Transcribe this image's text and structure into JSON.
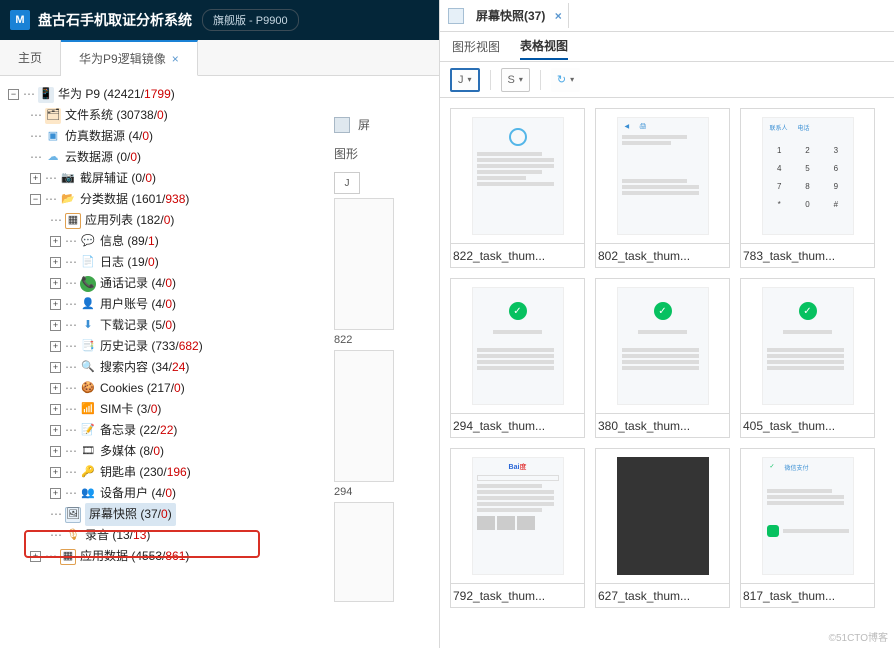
{
  "titlebar": {
    "logo": "M",
    "title": "盘古石手机取证分析系统",
    "badge": "旗舰版 - P9900"
  },
  "left_tabs": {
    "home": "主页",
    "active": "华为P9逻辑镜像"
  },
  "tree": {
    "root": {
      "label": "华为 P9 (42421/",
      "red": "1799",
      "tail": ")"
    },
    "fs": {
      "label": "文件系统 (30738/",
      "red": "0",
      "tail": ")"
    },
    "fake": {
      "label": "仿真数据源 (4/",
      "red": "0",
      "tail": ")"
    },
    "cloud": {
      "label": "云数据源 (0/",
      "red": "0",
      "tail": ")"
    },
    "screencap": {
      "label": "截屏辅证 (0/",
      "red": "0",
      "tail": ")"
    },
    "category": {
      "label": "分类数据 (1601/",
      "red": "938",
      "tail": ")"
    },
    "applist": {
      "label": "应用列表 (182/",
      "red": "0",
      "tail": ")"
    },
    "msg": {
      "label": "信息 (89/",
      "red": "1",
      "tail": ")"
    },
    "log": {
      "label": "日志 (19/",
      "red": "0",
      "tail": ")"
    },
    "call": {
      "label": "通话记录 (4/",
      "red": "0",
      "tail": ")"
    },
    "user": {
      "label": "用户账号 (4/",
      "red": "0",
      "tail": ")"
    },
    "download": {
      "label": "下载记录 (5/",
      "red": "0",
      "tail": ")"
    },
    "history": {
      "label": "历史记录 (733/",
      "red": "682",
      "tail": ")"
    },
    "search": {
      "label": "搜索内容 (34/",
      "red": "24",
      "tail": ")"
    },
    "cookies": {
      "label": "Cookies (217/",
      "red": "0",
      "tail": ")"
    },
    "sim": {
      "label": "SIM卡 (3/",
      "red": "0",
      "tail": ")"
    },
    "memo": {
      "label": "备忘录 (22/",
      "red": "22",
      "tail": ")"
    },
    "media": {
      "label": "多媒体 (8/",
      "red": "0",
      "tail": ")"
    },
    "keychain": {
      "label": "钥匙串 (230/",
      "red": "196",
      "tail": ")"
    },
    "devuser": {
      "label": "设备用户 (4/",
      "red": "0",
      "tail": ")"
    },
    "screenshot": {
      "label": "屏幕快照 (37/",
      "red": "0",
      "tail": ")"
    },
    "audio": {
      "label": "录音 (13/",
      "red": "13",
      "tail": ")"
    },
    "appdata": {
      "label": "应用数据 (4553/",
      "red": "861",
      "tail": ")"
    }
  },
  "mid": {
    "tab": "图形",
    "j": "J",
    "cap1": "822",
    "cap2": "294"
  },
  "right": {
    "tab_label": "屏幕快照(37)",
    "subtabs": {
      "graph": "图形视图",
      "table": "表格视图"
    },
    "toolbar": {
      "j": "J",
      "s": "S"
    },
    "thumbs": [
      "822_task_thum...",
      "802_task_thum...",
      "783_task_thum...",
      "294_task_thum...",
      "380_task_thum...",
      "405_task_thum...",
      "792_task_thum...",
      "627_task_thum...",
      "817_task_thum..."
    ]
  },
  "watermark": "©51CTO博客"
}
